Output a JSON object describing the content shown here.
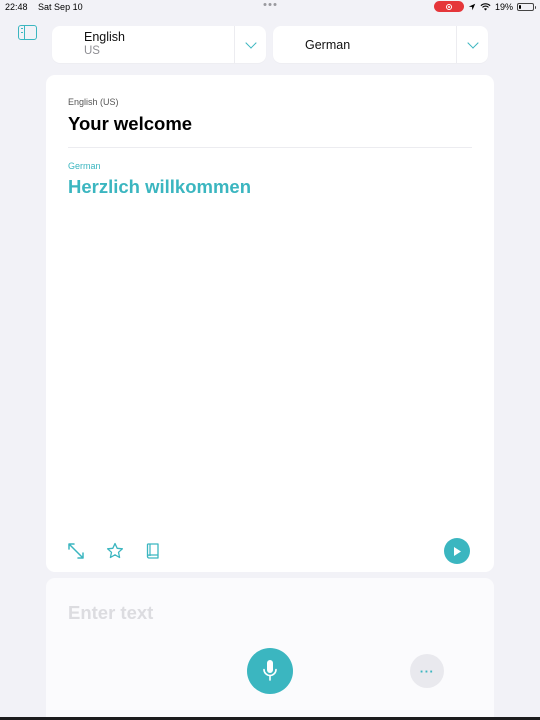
{
  "status_bar": {
    "time": "22:48",
    "date": "Sat Sep 10",
    "battery": "19%",
    "battery_level": 0.19
  },
  "language_selector": {
    "source_language": "English",
    "source_region": "US",
    "target_language": "German"
  },
  "translation": {
    "source_label": "English (US)",
    "source_text": "Your welcome",
    "target_label": "German",
    "target_text": "Herzlich willkommen"
  },
  "input": {
    "placeholder": "Enter text",
    "more_label": "···"
  },
  "icons": {
    "sidebar": "sidebar-icon",
    "expand": "expand-icon",
    "favorite": "star-icon",
    "dictionary": "book-icon",
    "play": "play-icon",
    "microphone": "microphone-icon",
    "more": "more-icon"
  },
  "colors": {
    "accent": "#3bb6c0",
    "background": "#f2f2f7",
    "recording": "#e5363a"
  }
}
